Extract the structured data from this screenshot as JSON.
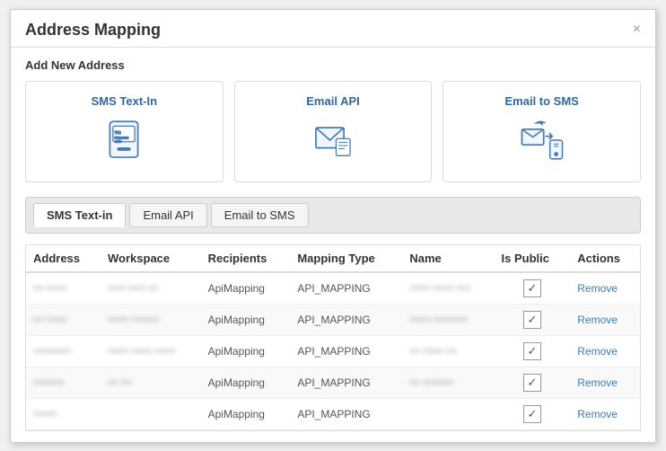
{
  "modal": {
    "title": "Address Mapping",
    "close_label": "×"
  },
  "add_new": {
    "label": "Add New Address"
  },
  "cards": [
    {
      "id": "sms-text-in",
      "label": "SMS Text-In",
      "icon": "sms"
    },
    {
      "id": "email-api",
      "label": "Email API",
      "icon": "email-api"
    },
    {
      "id": "email-to-sms",
      "label": "Email to SMS",
      "icon": "email-to-sms"
    }
  ],
  "tabs": [
    {
      "id": "sms-text-in",
      "label": "SMS Text-in",
      "active": true
    },
    {
      "id": "email-api",
      "label": "Email API",
      "active": false
    },
    {
      "id": "email-to-sms",
      "label": "Email to SMS",
      "active": false
    }
  ],
  "table": {
    "columns": [
      "Address",
      "Workspace",
      "Recipients",
      "Mapping Type",
      "Name",
      "Is Public",
      "Actions"
    ],
    "rows": [
      {
        "address": "••• ••••••",
        "workspace": "••••• ••••• •••",
        "recipients": "ApiMapping",
        "mapping_type": "API_MAPPING",
        "name": "•••••• •••••• ••••",
        "is_public": true,
        "action": "Remove"
      },
      {
        "address": "••• ••••••",
        "workspace": "•••••• ••••••••",
        "recipients": "ApiMapping",
        "mapping_type": "API_MAPPING",
        "name": "•••••• ••••••••••",
        "is_public": true,
        "action": "Remove"
      },
      {
        "address": "•••••••••••",
        "workspace": "•••••• •••••• ••••••",
        "recipients": "ApiMapping",
        "mapping_type": "API_MAPPING",
        "name": "••• •••••• •••",
        "is_public": true,
        "action": "Remove"
      },
      {
        "address": "•••••••••",
        "workspace": "••• •••",
        "recipients": "ApiMapping",
        "mapping_type": "API_MAPPING",
        "name": "••• •••••••••",
        "is_public": true,
        "action": "Remove"
      },
      {
        "address": "•••••••",
        "workspace": "",
        "recipients": "ApiMapping",
        "mapping_type": "API_MAPPING",
        "name": "",
        "is_public": true,
        "action": "Remove"
      }
    ]
  }
}
